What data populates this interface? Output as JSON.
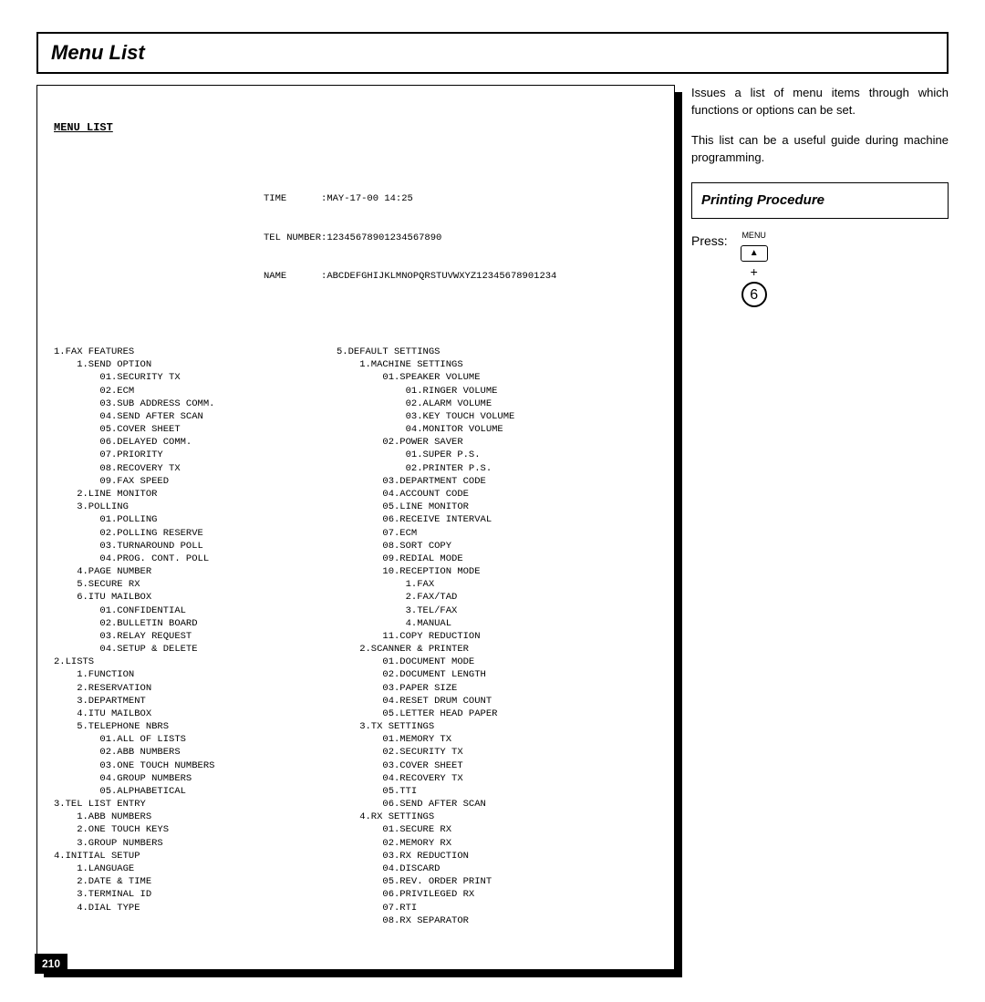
{
  "page": {
    "title": "Menu List",
    "number": "210"
  },
  "printout": {
    "heading": "MENU LIST",
    "meta": {
      "time_label": "TIME      :",
      "time": "MAY-17-00 14:25",
      "tel_label": "TEL NUMBER:",
      "tel": "12345678901234567890",
      "name_label": "NAME      :",
      "name": "ABCDEFGHIJKLMNOPQRSTUVWXYZ12345678901234"
    },
    "col_left": "1.FAX FEATURES\n    1.SEND OPTION\n        01.SECURITY TX\n        02.ECM\n        03.SUB ADDRESS COMM.\n        04.SEND AFTER SCAN\n        05.COVER SHEET\n        06.DELAYED COMM.\n        07.PRIORITY\n        08.RECOVERY TX\n        09.FAX SPEED\n    2.LINE MONITOR\n    3.POLLING\n        01.POLLING\n        02.POLLING RESERVE\n        03.TURNAROUND POLL\n        04.PROG. CONT. POLL\n    4.PAGE NUMBER\n    5.SECURE RX\n    6.ITU MAILBOX\n        01.CONFIDENTIAL\n        02.BULLETIN BOARD\n        03.RELAY REQUEST\n        04.SETUP & DELETE\n2.LISTS\n    1.FUNCTION\n    2.RESERVATION\n    3.DEPARTMENT\n    4.ITU MAILBOX\n    5.TELEPHONE NBRS\n        01.ALL OF LISTS\n        02.ABB NUMBERS\n        03.ONE TOUCH NUMBERS\n        04.GROUP NUMBERS\n        05.ALPHABETICAL\n3.TEL LIST ENTRY\n    1.ABB NUMBERS\n    2.ONE TOUCH KEYS\n    3.GROUP NUMBERS\n4.INITIAL SETUP\n    1.LANGUAGE\n    2.DATE & TIME\n    3.TERMINAL ID\n    4.DIAL TYPE",
    "col_right": "5.DEFAULT SETTINGS\n    1.MACHINE SETTINGS\n        01.SPEAKER VOLUME\n            01.RINGER VOLUME\n            02.ALARM VOLUME\n            03.KEY TOUCH VOLUME\n            04.MONITOR VOLUME\n        02.POWER SAVER\n            01.SUPER P.S.\n            02.PRINTER P.S.\n        03.DEPARTMENT CODE\n        04.ACCOUNT CODE\n        05.LINE MONITOR\n        06.RECEIVE INTERVAL\n        07.ECM\n        08.SORT COPY\n        09.REDIAL MODE\n        10.RECEPTION MODE\n            1.FAX\n            2.FAX/TAD\n            3.TEL/FAX\n            4.MANUAL\n        11.COPY REDUCTION\n    2.SCANNER & PRINTER\n        01.DOCUMENT MODE\n        02.DOCUMENT LENGTH\n        03.PAPER SIZE\n        04.RESET DRUM COUNT\n        05.LETTER HEAD PAPER\n    3.TX SETTINGS\n        01.MEMORY TX\n        02.SECURITY TX\n        03.COVER SHEET\n        04.RECOVERY TX\n        05.TTI\n        06.SEND AFTER SCAN\n    4.RX SETTINGS\n        01.SECURE RX\n        02.MEMORY RX\n        03.RX REDUCTION\n        04.DISCARD\n        05.REV. ORDER PRINT\n        06.PRIVILEGED RX\n        07.RTI\n        08.RX SEPARATOR"
  },
  "sidebar": {
    "para1": "Issues a list of menu items through which functions or options can be set.",
    "para2": "This list can be a useful guide during machine programming.",
    "subhead": "Printing Procedure",
    "press_label": "Press:",
    "menu_label": "MENU",
    "tri": "▲",
    "plus": "+",
    "digit": "6"
  }
}
